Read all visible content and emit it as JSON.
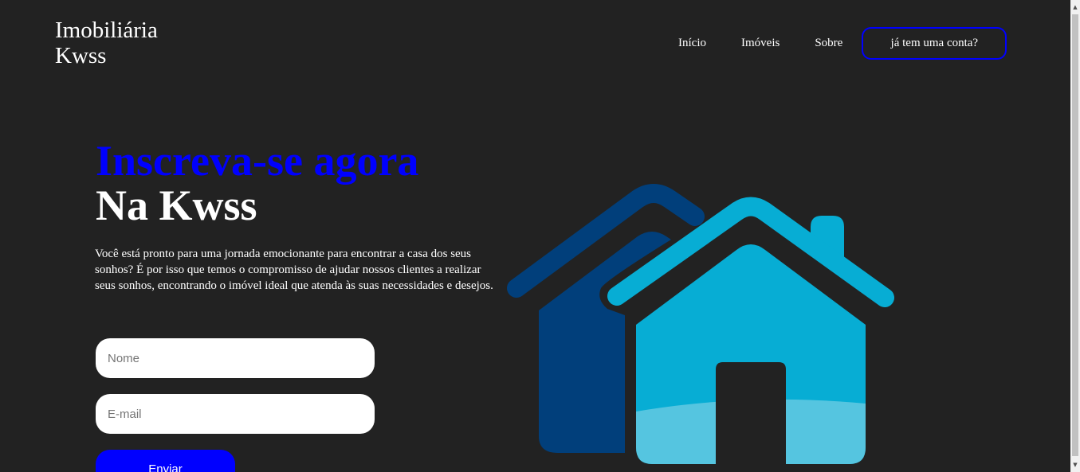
{
  "header": {
    "logo_line1": "Imobiliária",
    "logo_line2": "Kwss",
    "nav": {
      "home": "Início",
      "properties": "Imóveis",
      "about": "Sobre",
      "account": "já tem uma conta?"
    }
  },
  "hero": {
    "title_accent": "Inscreva-se agora",
    "title_brand": "Na Kwss",
    "description": "Você está pronto para uma jornada emocionante para encontrar a casa dos seus sonhos? É por isso que temos o compromisso de ajudar nossos clientes a realizar seus sonhos, encontrando o imóvel ideal que atenda às suas necessidades e desejos."
  },
  "form": {
    "name_placeholder": "Nome",
    "email_placeholder": "E-mail",
    "submit_label": "Enviar"
  },
  "illustration": {
    "icon": "house-icon"
  },
  "colors": {
    "background": "#222222",
    "accent": "#0000ff",
    "house_dark": "#013f7b",
    "house_light": "#07add4",
    "house_glass": "#55c5e0"
  }
}
